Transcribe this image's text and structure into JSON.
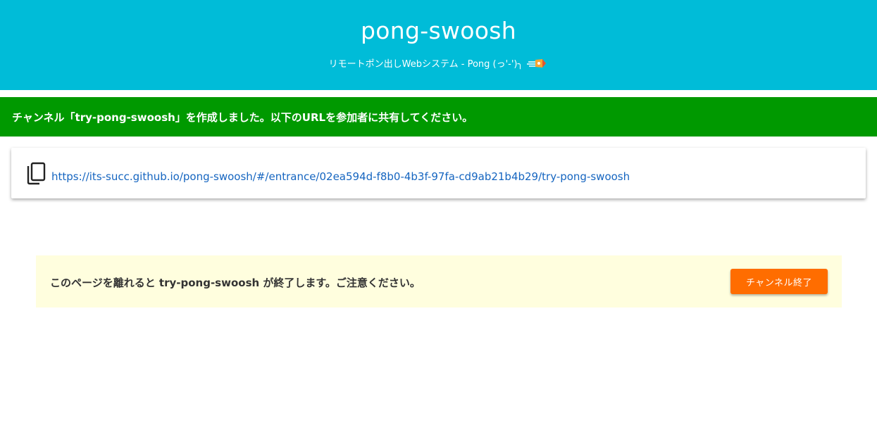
{
  "header": {
    "title": "pong-swoosh",
    "subtitle": "リモートポン出しWebシステム - Pong (っ'-')╮",
    "rocket_icon": "rocket-swoosh-icon"
  },
  "banner": {
    "message": "チャンネル「try-pong-swoosh」を作成しました。以下のURLを参加者に共有してください。",
    "color": "#009900"
  },
  "share": {
    "copy_icon": "copy-icon",
    "url": "https://its-succ.github.io/pong-swoosh/#/entrance/02ea594d-f8b0-4b3f-97fa-cd9ab21b4b29/try-pong-swoosh"
  },
  "notice": {
    "message": "このページを離れると try-pong-swoosh が終了します。ご注意ください。",
    "end_button_label": "チャンネル終了"
  },
  "colors": {
    "header_bg": "#00bcd8",
    "button_bg": "#ff6d00",
    "notice_bg": "#fffede",
    "link": "#1565c0"
  }
}
